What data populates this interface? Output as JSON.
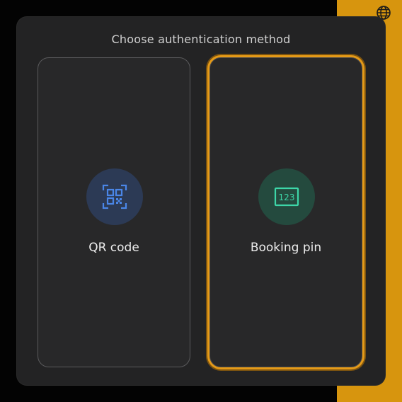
{
  "modal": {
    "title": "Choose authentication method",
    "options": [
      {
        "label": "QR code",
        "icon": "qr-code-icon",
        "accent": "#4a86e8"
      },
      {
        "label": "Booking pin",
        "icon": "keypad-123-icon",
        "accent": "#3dd6a8",
        "icon_text": "123",
        "selected": true
      }
    ]
  },
  "colors": {
    "selected_outline": "#e59a17",
    "background_accent": "#d7950e"
  }
}
